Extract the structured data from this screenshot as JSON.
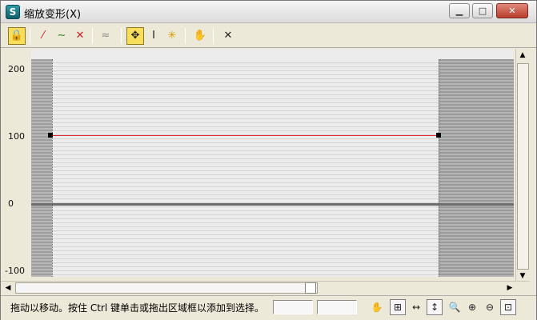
{
  "window": {
    "app_icon_glyph": "S",
    "title": "缩放变形(X)",
    "minimize_glyph": "▁",
    "maximize_glyph": "□",
    "close_glyph": "✕"
  },
  "toolbar": {
    "lock_glyph": "🔒",
    "x_curve_glyph": "⁄",
    "y_curve_glyph": "∼",
    "xy_curve_glyph": "✕",
    "mirror_glyph": "≈",
    "move_glyph": "✥",
    "scale_glyph": "Ι",
    "insert_glyph": "✳",
    "hand_glyph": "✋",
    "delete_glyph": "✕"
  },
  "graph": {
    "y_ticks": [
      "200",
      "100",
      "0",
      "-100"
    ],
    "curve_value": 100,
    "curve_color": "#e0262a"
  },
  "scrollbar": {
    "up_arrow": "▲",
    "down_arrow": "▼",
    "left_arrow": "◀",
    "right_arrow": "▶"
  },
  "status": {
    "message": "拖动以移动。按住 Ctrl 键单击或拖出区域框以添加到选择。",
    "field1_value": "",
    "field2_value": "",
    "pan_glyph": "✋",
    "zoom_extents_glyph": "⊞",
    "zoom_h_glyph": "↔",
    "zoom_v_glyph": "↕",
    "zoom_glyph": "🔍",
    "zoom_in_glyph": "⊕",
    "zoom_out_glyph": "⊖",
    "zoom_region_glyph": "⊡"
  }
}
